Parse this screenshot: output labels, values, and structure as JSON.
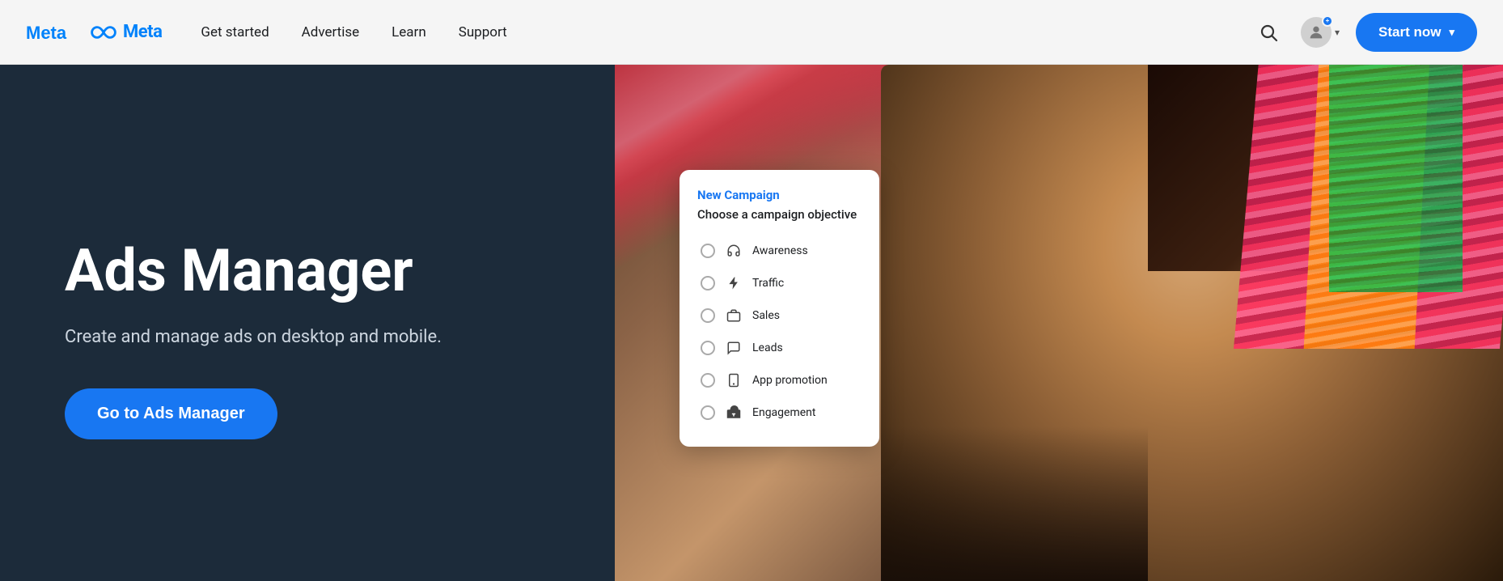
{
  "header": {
    "logo_alt": "Meta",
    "nav": {
      "items": [
        {
          "id": "get-started",
          "label": "Get started"
        },
        {
          "id": "advertise",
          "label": "Advertise"
        },
        {
          "id": "learn",
          "label": "Learn"
        },
        {
          "id": "support",
          "label": "Support"
        }
      ]
    },
    "start_now_label": "Start now"
  },
  "hero": {
    "title": "Ads Manager",
    "subtitle": "Create and manage ads on desktop and mobile.",
    "cta_label": "Go to Ads Manager"
  },
  "campaign_card": {
    "title": "New Campaign",
    "subtitle": "Choose a campaign objective",
    "options": [
      {
        "id": "awareness",
        "label": "Awareness",
        "icon": "📢"
      },
      {
        "id": "traffic",
        "label": "Traffic",
        "icon": "🖱"
      },
      {
        "id": "sales",
        "label": "Sales",
        "icon": "🏷"
      },
      {
        "id": "leads",
        "label": "Leads",
        "icon": "💬"
      },
      {
        "id": "app-promotion",
        "label": "App promotion",
        "icon": "📦"
      },
      {
        "id": "engagement",
        "label": "Engagement",
        "icon": "👍"
      }
    ]
  }
}
